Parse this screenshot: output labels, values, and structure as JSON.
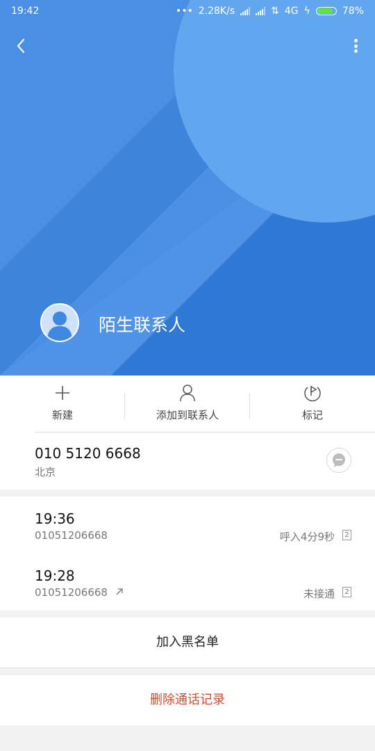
{
  "status_bar": {
    "time": "19:42",
    "speed": "2.28K/s",
    "network": "4G",
    "battery_percent": "78%",
    "battery_level": 0.78
  },
  "header": {
    "contact_name": "陌生联系人",
    "colors": {
      "bg": "#3f88e0",
      "accent": "#5fa3ec"
    }
  },
  "actions": [
    {
      "label": "新建",
      "icon": "plus-icon"
    },
    {
      "label": "添加到联系人",
      "icon": "person-icon"
    },
    {
      "label": "标记",
      "icon": "flag-icon"
    }
  ],
  "number_info": {
    "number": "010 5120 6668",
    "location": "北京",
    "message_icon": "message-icon"
  },
  "call_logs": [
    {
      "time": "19:36",
      "number": "01051206668",
      "status": "呼入4分9秒",
      "count": "2",
      "outgoing": false
    },
    {
      "time": "19:28",
      "number": "01051206668",
      "status": "未接通",
      "count": "2",
      "outgoing": true
    }
  ],
  "buttons": {
    "blacklist": "加入黑名单",
    "delete": "删除通话记录",
    "delete_color": "#d24a2d"
  }
}
